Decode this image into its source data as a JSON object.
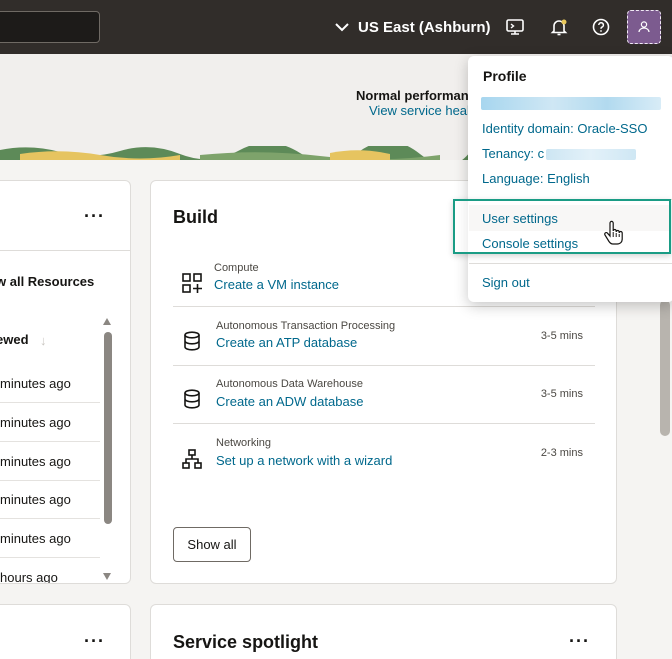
{
  "header": {
    "region": "US East (Ashburn)",
    "icons": [
      "cloud-shell-icon",
      "notification-bell-icon",
      "help-icon",
      "user-avatar-icon"
    ]
  },
  "banner": {
    "status_title": "Normal performanc",
    "status_link": "View service healt"
  },
  "left_card": {
    "view_all": "w all Resources",
    "column_header": "ewed",
    "rows": [
      "minutes ago",
      "minutes ago",
      "minutes ago",
      "minutes ago",
      "minutes ago",
      "hours ago"
    ]
  },
  "build": {
    "title": "Build",
    "tasks": [
      {
        "category": "Compute",
        "link": "Create a VM instance",
        "time": "",
        "icon": "compute-add-icon"
      },
      {
        "category": "Autonomous Transaction Processing",
        "link": "Create an ATP database",
        "time": "3-5 mins",
        "icon": "database-icon"
      },
      {
        "category": "Autonomous Data Warehouse",
        "link": "Create an ADW database",
        "time": "3-5 mins",
        "icon": "database-icon"
      },
      {
        "category": "Networking",
        "link": "Set up a network with a wizard",
        "time": "2-3 mins",
        "icon": "network-icon"
      }
    ],
    "show_all": "Show all"
  },
  "service_spotlight": {
    "title": "Service spotlight"
  },
  "profile_menu": {
    "title": "Profile",
    "identity_domain": "Identity domain: Oracle-SSO",
    "tenancy_label": "Tenancy: c",
    "language": "Language: English",
    "user_settings": "User settings",
    "console_settings": "Console settings",
    "sign_out": "Sign out"
  },
  "colors": {
    "topbar": "#312d2a",
    "link": "#00688c",
    "highlight_border": "#1a9c85",
    "avatar": "#7c5b8f"
  }
}
